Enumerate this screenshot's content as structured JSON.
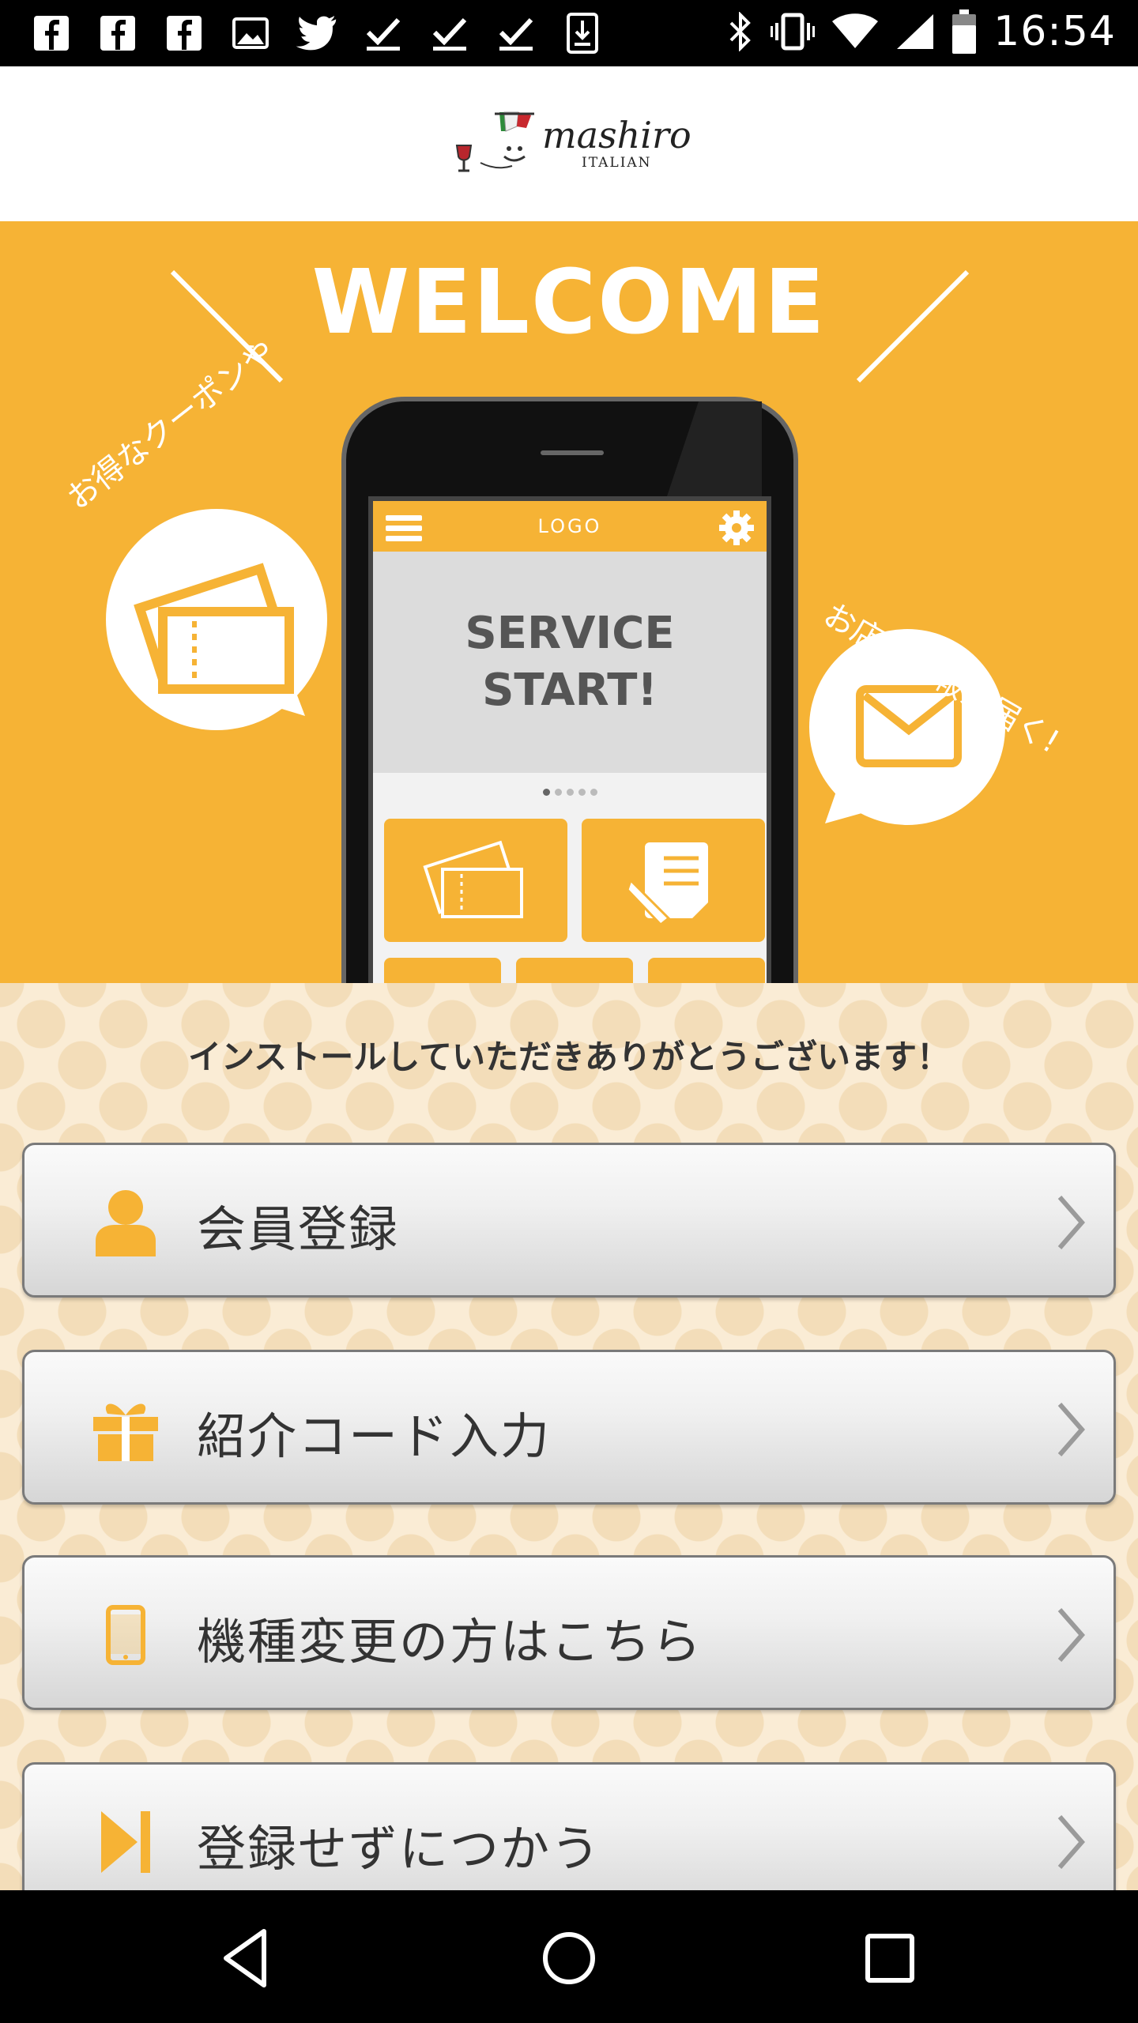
{
  "status_bar": {
    "time": "16:54",
    "left_icons": [
      "facebook-icon",
      "facebook-icon",
      "facebook-icon",
      "image-icon",
      "twitter-icon",
      "checkmark-icon",
      "checkmark-icon",
      "checkmark-icon",
      "download-icon"
    ],
    "right_icons": [
      "bluetooth-icon",
      "vibrate-icon",
      "wifi-icon",
      "cell-signal-icon",
      "battery-icon"
    ]
  },
  "header": {
    "logo_text": "mashiro",
    "logo_sub": "ITALIAN"
  },
  "hero": {
    "title": "WELCOME",
    "left_bubble_text": "お得なクーポンや",
    "right_bubble_text": "お店の情報が届く!",
    "phone": {
      "logo": "LOGO",
      "banner_line1": "SERVICE",
      "banner_line2": "START!"
    }
  },
  "thanks_message": "インストールしていただきありがとうございます！",
  "menu": [
    {
      "label": "会員登録",
      "icon": "person-icon"
    },
    {
      "label": "紹介コード入力",
      "icon": "gift-icon"
    },
    {
      "label": "機種変更の方はこちら",
      "icon": "smartphone-icon"
    },
    {
      "label": "登録せずにつかう",
      "icon": "skip-icon"
    }
  ],
  "colors": {
    "accent": "#f6b335",
    "background_pattern": "#faecd5"
  }
}
